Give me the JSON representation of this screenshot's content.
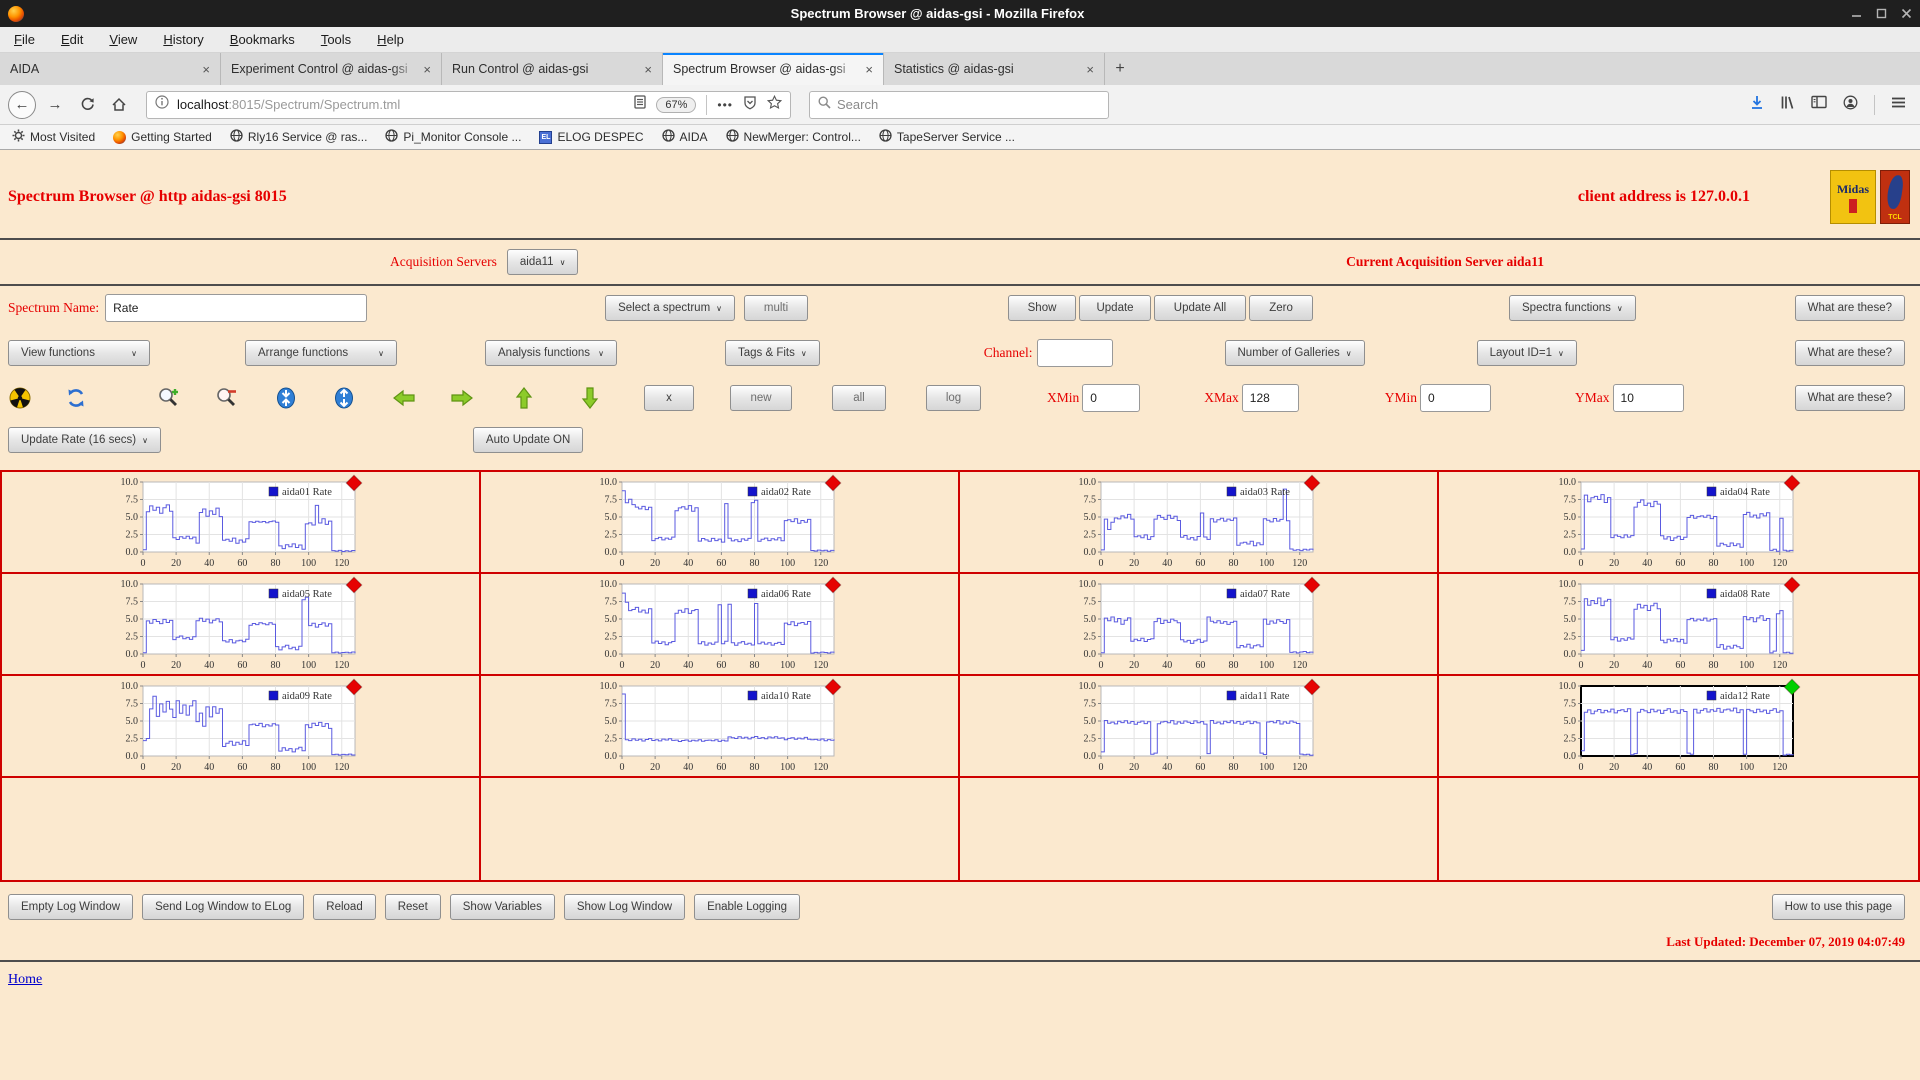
{
  "window": {
    "title": "Spectrum Browser @ aidas-gsi - Mozilla Firefox"
  },
  "menu_bar": {
    "items": [
      "File",
      "Edit",
      "View",
      "History",
      "Bookmarks",
      "Tools",
      "Help"
    ]
  },
  "tab_bar": {
    "tabs": [
      {
        "label": "AIDA"
      },
      {
        "label": "Experiment Control @ aidas-gsi"
      },
      {
        "label": "Run Control @ aidas-gsi"
      },
      {
        "label": "Spectrum Browser @ aidas-gsi"
      },
      {
        "label": "Statistics @ aidas-gsi"
      }
    ],
    "active_index": 3,
    "new_tab_label": "+"
  },
  "nav_bar": {
    "url_host": "localhost",
    "url_path": ":8015/Spectrum/Spectrum.tml",
    "zoom_level": "67%",
    "overflow_dots": "•••",
    "search_placeholder": "Search"
  },
  "bookmarks_bar": {
    "items": [
      {
        "label": "Most Visited",
        "icon": "gear-icon"
      },
      {
        "label": "Getting Started",
        "icon": "firefox-icon"
      },
      {
        "label": "Rly16 Service @ ras...",
        "icon": "globe-icon"
      },
      {
        "label": "Pi_Monitor Console ...",
        "icon": "globe-icon"
      },
      {
        "label": "ELOG DESPEC",
        "icon": "elog-icon"
      },
      {
        "label": "AIDA",
        "icon": "globe-icon"
      },
      {
        "label": "NewMerger: Control...",
        "icon": "globe-icon"
      },
      {
        "label": "TapeServer Service ...",
        "icon": "globe-icon"
      }
    ]
  },
  "page": {
    "title": "Spectrum Browser @ http aidas-gsi 8015",
    "client_address": "client address is 127.0.0.1",
    "logos": {
      "midas": "Midas",
      "tcl": "TCL"
    },
    "acquisition": {
      "label": "Acquisition Servers",
      "selected_server": "aida11",
      "current": "Current Acquisition Server aida11"
    },
    "spectrum_row": {
      "name_label": "Spectrum Name:",
      "name_value": "Rate",
      "select_spectrum": "Select a spectrum",
      "multi": "multi",
      "show": "Show",
      "update": "Update",
      "update_all": "Update All",
      "zero": "Zero",
      "spectra_functions": "Spectra functions",
      "what_are_these": "What are these?"
    },
    "functions_row": {
      "view": "View functions",
      "arrange": "Arrange functions",
      "analysis": "Analysis functions",
      "tags": "Tags & Fits",
      "channel_label": "Channel:",
      "channel_value": "",
      "galleries": "Number of Galleries",
      "layout": "Layout ID=1",
      "what_are_these": "What are these?"
    },
    "tools_row": {
      "icons": [
        "radiation-icon",
        "refresh-icon",
        "zoom-in-icon",
        "zoom-out-icon",
        "collapse-y-icon",
        "expand-y-icon",
        "arrow-left-icon",
        "arrow-right-icon",
        "arrow-up-icon",
        "arrow-down-icon"
      ],
      "buttons": [
        "x",
        "new",
        "all",
        "log"
      ],
      "xmin_label": "XMin",
      "xmin": "0",
      "xmax_label": "XMax",
      "xmax": "128",
      "ymin_label": "YMin",
      "ymin": "0",
      "ymax_label": "YMax",
      "ymax": "10",
      "what_are_these": "What are these?"
    },
    "update_row": {
      "update_rate": "Update Rate (16 secs)",
      "auto_update": "Auto Update ON"
    },
    "log_row": {
      "buttons": [
        "Empty Log Window",
        "Send Log Window to ELog",
        "Reload",
        "Reset",
        "Show Variables",
        "Show Log Window",
        "Enable Logging"
      ],
      "help": "How to use this page"
    },
    "last_updated": "Last Updated: December 07, 2019 04:07:49",
    "home": "Home"
  },
  "colors": {
    "page_bg": "#fbe9cf",
    "accent_red": "#e60000",
    "grid_border_red": "#cf0000",
    "link_blue": "#0000cc"
  },
  "chart_data": {
    "type": "line",
    "note": "12 gallery rate-vs-channel spectra; segments = [x_start, x_end, level, noise_amplitude], values estimated from pixels",
    "x_ticks": [
      0,
      20,
      40,
      60,
      80,
      100,
      120
    ],
    "y_ticks": [
      0,
      2.5,
      5,
      7.5,
      10
    ],
    "xlim": [
      0,
      128
    ],
    "ylim": [
      0,
      10
    ],
    "grid": true,
    "legend_position": "top-right",
    "sample_step": 2,
    "line_color": "#5a5ae0",
    "legend_swatch": "#1414cc",
    "marker_red": "#e60202",
    "marker_green": "#00cf00",
    "jitter": [
      0.1,
      -0.5,
      0.7,
      -0.2,
      0.4,
      -0.8,
      0.3,
      0.9,
      -0.4,
      0.15,
      -0.7,
      0.55,
      -0.1,
      0.8,
      -0.35,
      0.45,
      -0.9,
      0.05,
      0.6,
      -0.55,
      0.3,
      -0.25,
      0.75,
      -0.6,
      0.2,
      0.5,
      -0.15,
      0.85,
      -0.75,
      0.25,
      -0.4,
      0.65
    ],
    "charts": [
      {
        "id": "aida01",
        "legend": "aida01 Rate",
        "marker": "red",
        "selected": false,
        "segments": [
          [
            0,
            1,
            0.3,
            0.3
          ],
          [
            2,
            16,
            6.1,
            0.7
          ],
          [
            17,
            30,
            2.0,
            0.3
          ],
          [
            31,
            32,
            1.4,
            0.15
          ],
          [
            33,
            46,
            5.6,
            0.9
          ],
          [
            47,
            63,
            1.6,
            0.45
          ],
          [
            64,
            80,
            4.3,
            0.15
          ],
          [
            81,
            96,
            0.8,
            0.45
          ],
          [
            97,
            103,
            4.0,
            0.25
          ],
          [
            104,
            105,
            6.6,
            0.2
          ],
          [
            106,
            112,
            4.3,
            0.6
          ],
          [
            113,
            128,
            0.15,
            0.1
          ]
        ]
      },
      {
        "id": "aida02",
        "legend": "aida02 Rate",
        "marker": "red",
        "selected": false,
        "segments": [
          [
            0,
            1,
            8.2,
            0.6
          ],
          [
            2,
            6,
            7.4,
            0.9
          ],
          [
            7,
            17,
            6.2,
            0.4
          ],
          [
            18,
            30,
            1.9,
            0.3
          ],
          [
            31,
            45,
            6.2,
            0.5
          ],
          [
            46,
            60,
            1.7,
            0.35
          ],
          [
            61,
            63,
            6.8,
            0.4
          ],
          [
            64,
            77,
            1.7,
            0.3
          ],
          [
            78,
            80,
            7.2,
            0.4
          ],
          [
            81,
            96,
            1.8,
            0.3
          ],
          [
            97,
            112,
            4.4,
            0.4
          ],
          [
            113,
            128,
            0.2,
            0.1
          ]
        ]
      },
      {
        "id": "aida03",
        "legend": "aida03 Rate",
        "marker": "red",
        "selected": false,
        "segments": [
          [
            0,
            1,
            0.4,
            0.3
          ],
          [
            2,
            8,
            4.2,
            1.1
          ],
          [
            9,
            18,
            5.0,
            0.5
          ],
          [
            19,
            30,
            2.1,
            0.4
          ],
          [
            31,
            46,
            4.9,
            0.5
          ],
          [
            47,
            58,
            2.0,
            0.4
          ],
          [
            59,
            60,
            5.6,
            0.3
          ],
          [
            61,
            64,
            1.9,
            0.3
          ],
          [
            65,
            80,
            4.6,
            0.35
          ],
          [
            81,
            96,
            1.2,
            0.4
          ],
          [
            97,
            109,
            4.5,
            0.4
          ],
          [
            110,
            111,
            9.3,
            0.4
          ],
          [
            112,
            112,
            4.4,
            0.2
          ],
          [
            113,
            128,
            0.3,
            0.15
          ]
        ]
      },
      {
        "id": "aida04",
        "legend": "aida04 Rate",
        "marker": "red",
        "selected": false,
        "segments": [
          [
            0,
            1,
            0.5,
            0.3
          ],
          [
            2,
            16,
            7.6,
            0.7
          ],
          [
            17,
            30,
            2.2,
            0.35
          ],
          [
            31,
            46,
            6.9,
            0.6
          ],
          [
            47,
            63,
            2.0,
            0.4
          ],
          [
            64,
            80,
            5.0,
            0.3
          ],
          [
            81,
            96,
            1.0,
            0.4
          ],
          [
            97,
            112,
            5.2,
            0.5
          ],
          [
            113,
            118,
            0.3,
            0.2
          ],
          [
            119,
            120,
            4.8,
            0.3
          ],
          [
            121,
            128,
            0.2,
            0.1
          ]
        ]
      },
      {
        "id": "aida05",
        "legend": "aida05 Rate",
        "marker": "red",
        "selected": false,
        "segments": [
          [
            0,
            1,
            0.4,
            0.3
          ],
          [
            2,
            17,
            4.6,
            0.5
          ],
          [
            18,
            31,
            2.3,
            0.3
          ],
          [
            32,
            46,
            4.8,
            0.4
          ],
          [
            47,
            63,
            1.8,
            0.35
          ],
          [
            64,
            79,
            4.3,
            0.25
          ],
          [
            80,
            95,
            0.9,
            0.4
          ],
          [
            96,
            98,
            7.8,
            0.4
          ],
          [
            99,
            112,
            4.2,
            0.4
          ],
          [
            113,
            128,
            0.2,
            0.1
          ]
        ]
      },
      {
        "id": "aida06",
        "legend": "aida06 Rate",
        "marker": "red",
        "selected": false,
        "segments": [
          [
            0,
            1,
            8.8,
            0.5
          ],
          [
            2,
            5,
            7.0,
            1.0
          ],
          [
            6,
            16,
            6.2,
            0.5
          ],
          [
            17,
            30,
            1.6,
            0.3
          ],
          [
            31,
            45,
            6.1,
            0.5
          ],
          [
            46,
            56,
            1.5,
            0.3
          ],
          [
            57,
            59,
            7.0,
            0.5
          ],
          [
            60,
            63,
            1.6,
            0.3
          ],
          [
            64,
            65,
            7.2,
            0.4
          ],
          [
            66,
            78,
            1.5,
            0.3
          ],
          [
            79,
            81,
            7.0,
            0.4
          ],
          [
            82,
            96,
            1.5,
            0.25
          ],
          [
            97,
            112,
            4.3,
            0.4
          ],
          [
            113,
            128,
            0.2,
            0.1
          ]
        ]
      },
      {
        "id": "aida07",
        "legend": "aida07 Rate",
        "marker": "red",
        "selected": false,
        "segments": [
          [
            0,
            1,
            0.4,
            0.3
          ],
          [
            2,
            17,
            4.8,
            0.6
          ],
          [
            18,
            30,
            2.0,
            0.35
          ],
          [
            31,
            46,
            4.7,
            0.45
          ],
          [
            47,
            62,
            1.8,
            0.35
          ],
          [
            63,
            64,
            5.5,
            0.3
          ],
          [
            65,
            80,
            4.5,
            0.3
          ],
          [
            81,
            96,
            1.1,
            0.4
          ],
          [
            97,
            112,
            4.6,
            0.45
          ],
          [
            113,
            128,
            0.25,
            0.12
          ]
        ]
      },
      {
        "id": "aida08",
        "legend": "aida08 Rate",
        "marker": "red",
        "selected": false,
        "segments": [
          [
            0,
            1,
            0.5,
            0.3
          ],
          [
            2,
            16,
            7.4,
            0.8
          ],
          [
            17,
            30,
            2.1,
            0.35
          ],
          [
            31,
            46,
            6.7,
            0.6
          ],
          [
            47,
            63,
            1.9,
            0.4
          ],
          [
            64,
            80,
            4.9,
            0.3
          ],
          [
            81,
            96,
            1.0,
            0.4
          ],
          [
            97,
            112,
            5.0,
            0.5
          ],
          [
            113,
            117,
            0.3,
            0.2
          ],
          [
            118,
            120,
            5.8,
            0.5
          ],
          [
            121,
            128,
            0.2,
            0.1
          ]
        ]
      },
      {
        "id": "aida09",
        "legend": "aida09 Rate",
        "marker": "red",
        "selected": false,
        "segments": [
          [
            0,
            2,
            2.0,
            1.0
          ],
          [
            3,
            12,
            7.0,
            1.8
          ],
          [
            13,
            22,
            6.5,
            2.0
          ],
          [
            23,
            30,
            6.8,
            1.2
          ],
          [
            31,
            40,
            5.8,
            2.2
          ],
          [
            41,
            46,
            6.4,
            0.8
          ],
          [
            47,
            63,
            1.8,
            0.5
          ],
          [
            64,
            80,
            4.4,
            0.3
          ],
          [
            81,
            96,
            0.9,
            0.4
          ],
          [
            97,
            112,
            4.4,
            0.5
          ],
          [
            113,
            128,
            0.2,
            0.1
          ]
        ]
      },
      {
        "id": "aida10",
        "legend": "aida10 Rate",
        "marker": "red",
        "selected": false,
        "segments": [
          [
            0,
            1,
            8.6,
            0.4
          ],
          [
            2,
            30,
            2.3,
            0.2
          ],
          [
            31,
            63,
            2.2,
            0.15
          ],
          [
            64,
            95,
            2.6,
            0.2
          ],
          [
            96,
            112,
            2.5,
            0.2
          ],
          [
            113,
            128,
            2.3,
            0.15
          ]
        ]
      },
      {
        "id": "aida11",
        "legend": "aida11 Rate",
        "marker": "red",
        "selected": false,
        "segments": [
          [
            0,
            1,
            0.5,
            0.3
          ],
          [
            2,
            29,
            4.8,
            0.3
          ],
          [
            30,
            32,
            0.3,
            0.15
          ],
          [
            33,
            62,
            4.8,
            0.3
          ],
          [
            63,
            65,
            0.3,
            0.15
          ],
          [
            66,
            95,
            4.8,
            0.3
          ],
          [
            96,
            98,
            0.3,
            0.15
          ],
          [
            99,
            119,
            4.8,
            0.3
          ],
          [
            120,
            128,
            0.2,
            0.1
          ]
        ]
      },
      {
        "id": "aida12",
        "legend": "aida12 Rate",
        "marker": "green",
        "selected": true,
        "segments": [
          [
            0,
            1,
            0.5,
            0.3
          ],
          [
            2,
            29,
            6.4,
            0.4
          ],
          [
            30,
            32,
            0.3,
            0.15
          ],
          [
            33,
            63,
            6.4,
            0.4
          ],
          [
            64,
            66,
            0.3,
            0.15
          ],
          [
            67,
            96,
            6.5,
            0.4
          ],
          [
            97,
            99,
            0.3,
            0.15
          ],
          [
            100,
            120,
            6.4,
            0.4
          ],
          [
            121,
            128,
            0.2,
            0.1
          ]
        ]
      }
    ]
  }
}
